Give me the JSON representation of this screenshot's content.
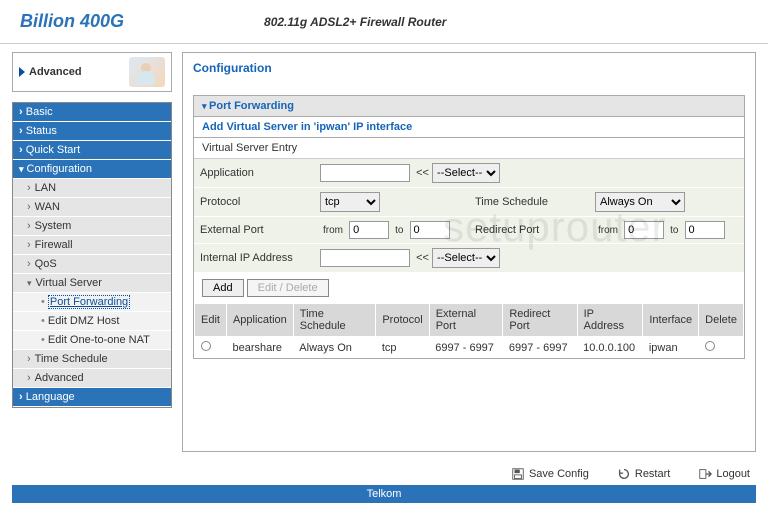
{
  "header": {
    "brand": "Billion 400G",
    "subtitle": "802.11g ADSL2+ Firewall Router"
  },
  "tab": {
    "label": "Advanced"
  },
  "nav": {
    "basic": "Basic",
    "status": "Status",
    "quick": "Quick Start",
    "config": "Configuration",
    "lan": "LAN",
    "wan": "WAN",
    "system": "System",
    "firewall": "Firewall",
    "qos": "QoS",
    "vserver": "Virtual Server",
    "portfwd": "Port Forwarding",
    "dmz": "Edit DMZ Host",
    "nat": "Edit One-to-one NAT",
    "tsched": "Time Schedule",
    "adv": "Advanced",
    "lang": "Language"
  },
  "content": {
    "title": "Configuration",
    "section": "Port Forwarding",
    "subtitle": "Add Virtual Server in 'ipwan' IP interface",
    "entry": "Virtual Server Entry",
    "labels": {
      "application": "Application",
      "protocol": "Protocol",
      "timesched": "Time Schedule",
      "extport": "External Port",
      "redport": "Redirect Port",
      "intip": "Internal IP Address",
      "from": "from",
      "to": "to",
      "selectbtn": "<<"
    },
    "values": {
      "app_input": "",
      "app_select": "--Select--",
      "protocol": "tcp",
      "timesched": "Always On",
      "ext_from": "0",
      "ext_to": "0",
      "red_from": "0",
      "red_to": "0",
      "intip_input": "",
      "intip_select": "--Select--"
    },
    "buttons": {
      "add": "Add",
      "editdelete": "Edit / Delete"
    }
  },
  "table": {
    "headers": {
      "edit": "Edit",
      "app": "Application",
      "ts": "Time Schedule",
      "proto": "Protocol",
      "ext": "External Port",
      "red": "Redirect Port",
      "ip": "IP Address",
      "iface": "Interface",
      "del": "Delete"
    },
    "row": {
      "app": "bearshare",
      "ts": "Always On",
      "proto": "tcp",
      "ext": "6997 - 6997",
      "red": "6997 - 6997",
      "ip": "10.0.0.100",
      "iface": "ipwan"
    }
  },
  "footer": {
    "save": "Save Config",
    "restart": "Restart",
    "logout": "Logout",
    "brand": "Telkom"
  },
  "watermark": "setuprouter"
}
